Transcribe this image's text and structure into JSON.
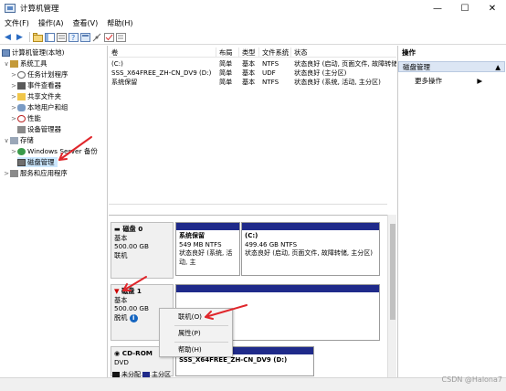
{
  "window": {
    "title": "计算机管理",
    "min": "—",
    "max": "☐",
    "close": "✕"
  },
  "menu": [
    "文件(F)",
    "操作(A)",
    "查看(V)",
    "帮助(H)"
  ],
  "tree": {
    "root": "计算机管理(本地)",
    "system_tools": "系统工具",
    "task_scheduler": "任务计划程序",
    "event_viewer": "事件查看器",
    "shared_folders": "共享文件夹",
    "local_users": "本地用户和组",
    "performance": "性能",
    "device_manager": "设备管理器",
    "storage": "存储",
    "windows_backup": "Windows Server 备份",
    "disk_management": "磁盘管理",
    "services_apps": "服务和应用程序"
  },
  "volume_list": {
    "columns": [
      "卷",
      "布局",
      "类型",
      "文件系统",
      "状态"
    ],
    "rows": [
      {
        "volume": "(C:)",
        "layout": "简单",
        "type": "基本",
        "fs": "NTFS",
        "status": "状态良好 (启动, 页面文件, 故障转储"
      },
      {
        "volume": "SSS_X64FREE_ZH-CN_DV9 (D:)",
        "layout": "简单",
        "type": "基本",
        "fs": "UDF",
        "status": "状态良好 (主分区)"
      },
      {
        "volume": "系统保留",
        "layout": "简单",
        "type": "基本",
        "fs": "NTFS",
        "status": "状态良好 (系统, 活动, 主分区)"
      }
    ]
  },
  "disks": {
    "disk0": {
      "title": "磁盘 0",
      "type": "基本",
      "size": "500.00 GB",
      "status": "联机",
      "partitions": [
        {
          "name": "系统保留",
          "size": "549 MB NTFS",
          "status": "状态良好 (系统, 活动, 主"
        },
        {
          "name": "(C:)",
          "size": "499.46 GB NTFS",
          "status": "状态良好 (启动, 页面文件, 故障转储, 主分区)"
        }
      ]
    },
    "disk1": {
      "title": "磁盘 1",
      "type": "基本",
      "size": "500.00 GB",
      "status": "脱机",
      "info_icon": "i"
    },
    "cdrom": {
      "title": "CD-ROM",
      "type": "DVD",
      "volume": "SSS_X64FREE_ZH-CN_DV9 (D:)"
    }
  },
  "context_menu": {
    "online": "联机(O)",
    "properties": "属性(P)",
    "help": "帮助(H)"
  },
  "actions": {
    "title": "操作",
    "group": "磁盘管理",
    "more": "更多操作"
  },
  "legend": {
    "unallocated": "未分配",
    "primary": "主分区"
  },
  "watermark": "CSDN @Halona7",
  "colors": {
    "primary_partition": "#1f2a8a",
    "unallocated": "#141414",
    "selection": "#cce8ff",
    "arrow": "#e0262b"
  }
}
